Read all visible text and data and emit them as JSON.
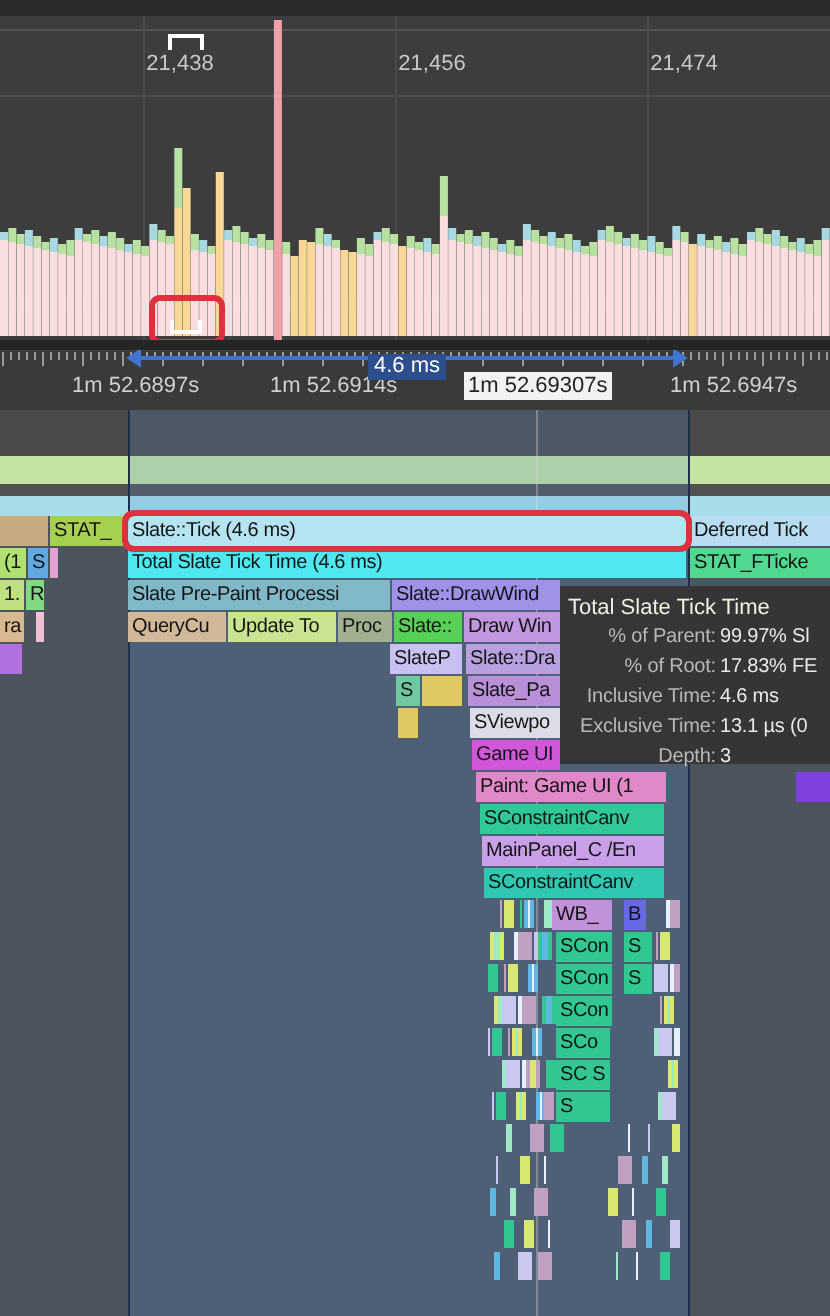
{
  "frames_chart": {
    "frame_labels": [
      "21,438",
      "21,456",
      "21,474"
    ],
    "marked_frame_outlined": true
  },
  "time_ruler": {
    "ticks": [
      {
        "label": "1m 52.6897s",
        "hovered": false
      },
      {
        "label": "1m 52.6914s",
        "hovered": false
      },
      {
        "label": "1m 52.69307s",
        "hovered": true
      },
      {
        "label": "1m 52.6947s",
        "hovered": false
      }
    ],
    "selection_duration": "4.6 ms"
  },
  "tracks": [
    {
      "events": [
        {
          "color": "#c8aa80",
          "outlined": false
        },
        {
          "label": "STAT_",
          "color": "#a8d050",
          "outlined": false
        },
        {
          "label": "Slate::Tick (4.6 ms)",
          "color": "#b4e4f0",
          "outlined": true
        },
        {
          "label": "Deferred Tick",
          "color": "#b8dcf0",
          "outlined": false
        }
      ]
    },
    {
      "events": [
        {
          "label": "(1",
          "color": "#b0e070",
          "outlined": false
        },
        {
          "label": "S",
          "color": "#60a8e0",
          "outlined": false
        },
        {
          "color": "#e0a0d0",
          "outlined": false
        },
        {
          "label": "Total Slate Tick Time (4.6 ms)",
          "color": "#50e8f0",
          "outlined": false
        },
        {
          "label": "STAT_FTicke",
          "color": "#50d890",
          "outlined": false
        }
      ]
    },
    {
      "events": [
        {
          "label": "1.",
          "color": "#c0e080",
          "outlined": false
        },
        {
          "label": "R",
          "color": "#80d880",
          "outlined": false
        },
        {
          "label": "Slate Pre-Paint Processi",
          "color": "#80b8c8",
          "outlined": false
        },
        {
          "label": "Slate::DrawWind",
          "color": "#a090e8",
          "outlined": false
        }
      ]
    },
    {
      "events": [
        {
          "label": "ra",
          "color": "#d8b890",
          "outlined": false
        },
        {
          "color": "#f0c0d8",
          "outlined": false
        },
        {
          "label": "QueryCu",
          "color": "#d0b898",
          "outlined": false
        },
        {
          "label": "Update To",
          "color": "#c8e490",
          "outlined": false
        },
        {
          "label": "Proc",
          "color": "#a0b090",
          "outlined": false
        },
        {
          "label": "Slate::",
          "color": "#58d058",
          "outlined": false
        },
        {
          "label": "Draw Win",
          "color": "#c098e0",
          "outlined": false
        }
      ]
    },
    {
      "events": [
        {
          "color": "#b070e0",
          "outlined": false
        },
        {
          "label": "SlateP",
          "color": "#c8c0f0",
          "outlined": false
        },
        {
          "label": "Slate::Dra",
          "color": "#b8a0e0",
          "outlined": false
        }
      ]
    },
    {
      "events": [
        {
          "label": "S",
          "color": "#70c8a0",
          "outlined": false
        },
        {
          "color": "#e0c860",
          "outlined": false
        },
        {
          "label": "Slate_Pa",
          "color": "#b890d8",
          "outlined": false
        }
      ]
    },
    {
      "events": [
        {
          "color": "#e0c860",
          "outlined": false
        },
        {
          "label": "SViewpo",
          "color": "#dcdce8",
          "outlined": false
        }
      ]
    },
    {
      "events": [
        {
          "label": "Game UI",
          "color": "#d058d8",
          "outlined": false
        }
      ]
    },
    {
      "events": [
        {
          "label": "Paint: Game UI (1",
          "color": "#e088c8",
          "outlined": false
        },
        {
          "color": "#8040e0",
          "outlined": false
        }
      ]
    },
    {
      "events": [
        {
          "label": "SConstraintCanv",
          "color": "#30c898",
          "outlined": false
        }
      ]
    },
    {
      "events": [
        {
          "label": "MainPanel_C /En",
          "color": "#c8a0e8",
          "outlined": false
        }
      ]
    },
    {
      "events": [
        {
          "label": "SConstraintCanv",
          "color": "#30c8b0",
          "outlined": false
        }
      ]
    },
    {
      "events": [
        {
          "label": "WB_",
          "color": "#c090d8",
          "outlined": false
        },
        {
          "label": "B",
          "color": "#6868e8",
          "outlined": false
        }
      ]
    },
    {
      "events": [
        {
          "label": "SCon",
          "color": "#30c890",
          "outlined": false
        },
        {
          "label": "S",
          "color": "#30c890",
          "outlined": false
        }
      ]
    },
    {
      "events": [
        {
          "label": "SCon",
          "color": "#30c890",
          "outlined": false
        },
        {
          "label": "S",
          "color": "#30c890",
          "outlined": false
        }
      ]
    },
    {
      "events": [
        {
          "label": "SCon",
          "color": "#30c890",
          "outlined": false
        }
      ]
    },
    {
      "events": [
        {
          "label": "SCo",
          "color": "#30c890",
          "outlined": false
        }
      ]
    },
    {
      "events": [
        {
          "label": "SC S",
          "color": "#30c890",
          "outlined": false
        }
      ]
    },
    {
      "events": [
        {
          "label": "S",
          "color": "#30c890",
          "outlined": false
        }
      ]
    }
  ],
  "tooltip": {
    "title": "Total Slate Tick Time",
    "rows": [
      {
        "label": "% of Parent:",
        "value": "99.97% Sl"
      },
      {
        "label": "% of Root:",
        "value": "17.83% FE"
      },
      {
        "label": "Inclusive Time:",
        "value": "4.6 ms"
      },
      {
        "label": "Exclusive Time:",
        "value": "13.1 µs (0"
      },
      {
        "label": "Depth:",
        "value": "3"
      }
    ]
  }
}
